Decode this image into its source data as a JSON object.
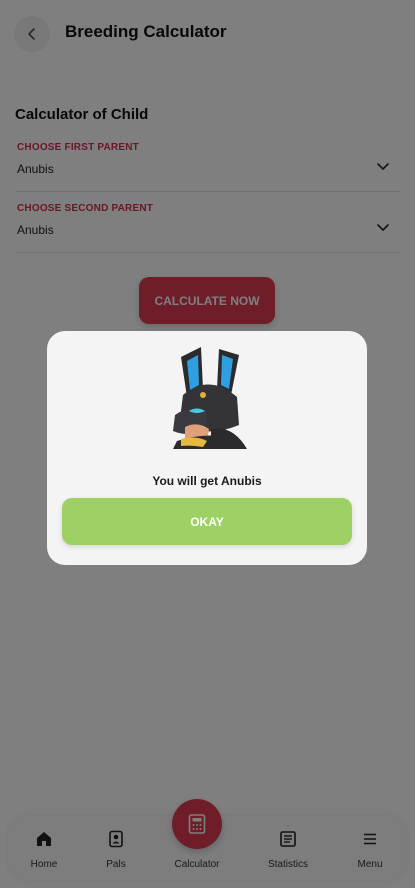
{
  "header": {
    "title": "Breeding Calculator",
    "back_icon": "chevron-left-icon"
  },
  "calculator": {
    "section_title": "Calculator of Child",
    "first_parent": {
      "label": "CHOOSE FIRST PARENT",
      "value": "Anubis"
    },
    "second_parent": {
      "label": "CHOOSE SECOND PARENT",
      "value": "Anubis"
    },
    "calculate_button": "CALCULATE NOW"
  },
  "dialog": {
    "pal_name": "Anubis",
    "message": "You will get Anubis",
    "okay_button": "OKAY"
  },
  "bottom_nav": {
    "items": [
      {
        "label": "Home",
        "icon": "home-icon"
      },
      {
        "label": "Pals",
        "icon": "pals-card-icon"
      },
      {
        "label": "Calculator",
        "icon": "calculator-icon"
      },
      {
        "label": "Statistics",
        "icon": "statistics-icon"
      },
      {
        "label": "Menu",
        "icon": "menu-icon"
      }
    ]
  },
  "colors": {
    "accent_red": "#dd3a52",
    "label_red": "#d1314c",
    "okay_green": "#9ed163",
    "overlay": "rgba(0,0,0,0.5)"
  }
}
